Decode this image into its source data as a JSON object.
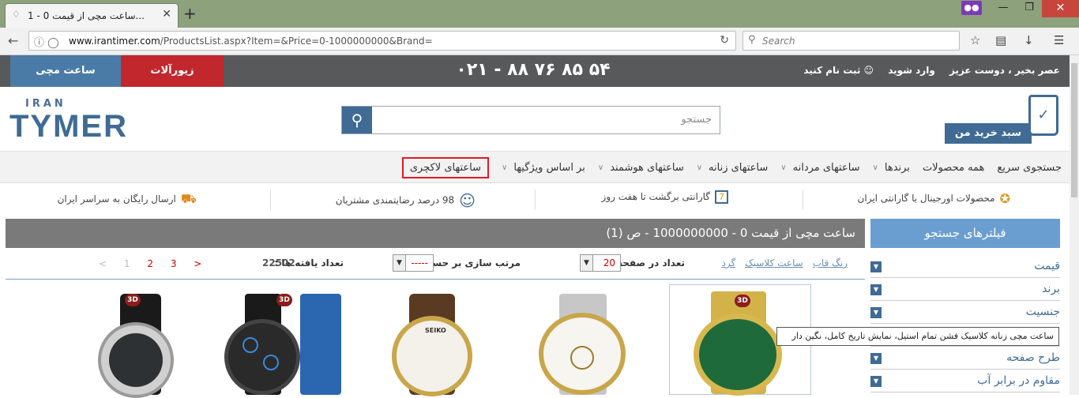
{
  "browser": {
    "tab_title": "ساعت مچی از قیمت 0 - 1...",
    "url_domain": "www.irantimer.com",
    "url_path": "/ProductsList.aspx?Item=&Price=0-1000000000&Brand=",
    "search_placeholder": "Search"
  },
  "topstrip": {
    "watch_button": "ساعت مچی",
    "jewelry_button": "زیورآلات",
    "phone": "۰۲۱ - ۸۸ ۷۶ ۸۵ ۵۴",
    "greeting": "عصر بخیر ، دوست عزیز",
    "login": "وارد شوید",
    "register": "ثبت نام کنید"
  },
  "header": {
    "logo_small": "IRAN",
    "logo_big": "TYMER",
    "search_placeholder": "جستجو",
    "cart_label": "سبد خرید من"
  },
  "menu": {
    "items": [
      "جستجوی سریع",
      "همه محصولات",
      "برندها",
      "ساعتهای مردانه",
      "ساعتهای زنانه",
      "ساعتهای هوشمند",
      "بر اساس ویژگیها",
      "ساعتهای لاکچری"
    ]
  },
  "benefits": {
    "original": "محصولات اورجینال با گارانتی ایران",
    "return": "گارانتی برگشت تا هفت روز",
    "return_icon_num": "7",
    "satisfaction": "98 درصد رضایتمندی مشتریان",
    "shipping": "ارسال رایگان به سراسر ایران"
  },
  "sidebar": {
    "title": "فیلترهای جستجو",
    "filters": [
      "قیمت",
      "برند",
      "جنسیت",
      "",
      "طرح صفحه",
      "مقاوم در برابر آب"
    ]
  },
  "results": {
    "title": "ساعت مچی از قیمت 0 - 1000000000 - ص (1)",
    "tag_links": [
      "رنگ قاب",
      "ساعت کلاسیک",
      "گرد"
    ],
    "per_page_label": "تعداد در صفحه:",
    "per_page_value": "20",
    "sort_label": "مرتب سازی بر حسب:",
    "sort_value": "-----",
    "found_label": "تعداد یافته ها :",
    "found_count": "22502",
    "pages": [
      "<",
      "1",
      "2",
      "3",
      ">"
    ]
  },
  "products": {
    "badge": "3D",
    "tooltip": "ساعت مچی زنانه کلاسیک فشن تمام استیل، نمایش تاریخ کامل، نگین دار"
  }
}
